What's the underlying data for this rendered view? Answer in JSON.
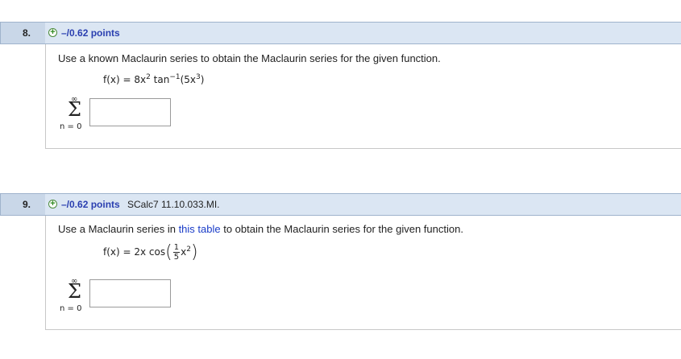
{
  "questions": [
    {
      "number": "8.",
      "points": "–/0.62 points",
      "source": "",
      "prompt_pre": "Use a known Maclaurin series to obtain the Maclaurin series for the given function.",
      "prompt_link": "",
      "prompt_post": "",
      "function_text": "f(x) = 8x² tan⁻¹(5x³)",
      "sum_upper": "∞",
      "sum_lower": "n = 0",
      "sigma": "Σ",
      "answer_value": ""
    },
    {
      "number": "9.",
      "points": "–/0.62 points",
      "source": "SCalc7 11.10.033.MI.",
      "prompt_pre": "Use a Maclaurin series in ",
      "prompt_link": "this table",
      "prompt_post": " to obtain the Maclaurin series for the given function.",
      "function_lhs": "f(x) = 2x cos",
      "frac_num": "1",
      "frac_den": "5",
      "function_tail": "x²",
      "sum_upper": "∞",
      "sum_lower": "n = 0",
      "sigma": "Σ",
      "answer_value": ""
    }
  ],
  "colors": {
    "header_bg": "#dbe6f3",
    "number_bg": "#c9d7e8",
    "points_color": "#2a3fb0",
    "link_color": "#1a3cc8"
  },
  "icons": {
    "expand": "plus-circle-icon"
  }
}
